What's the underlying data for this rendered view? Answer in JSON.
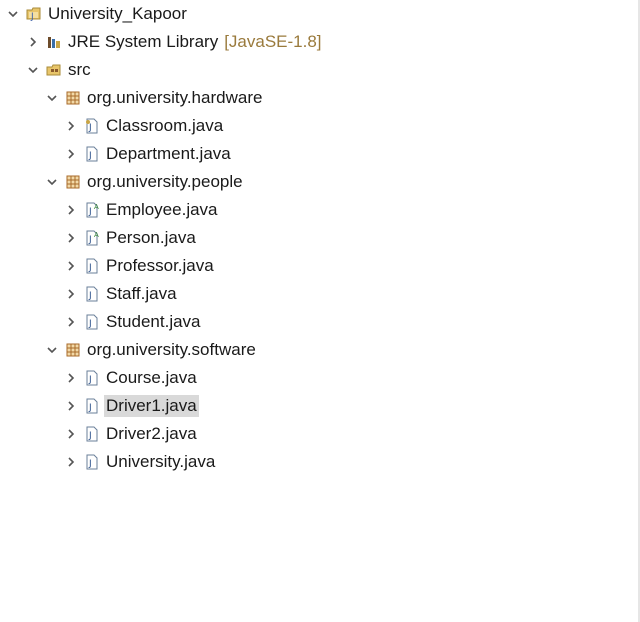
{
  "tree": {
    "project": {
      "label": "University_Kapoor"
    },
    "jre": {
      "label": "JRE System Library",
      "decoration": "[JavaSE-1.8]"
    },
    "src": {
      "label": "src"
    },
    "packages": [
      {
        "label": "org.university.hardware",
        "files": [
          {
            "label": "Classroom.java"
          },
          {
            "label": "Department.java"
          }
        ]
      },
      {
        "label": "org.university.people",
        "files": [
          {
            "label": "Employee.java"
          },
          {
            "label": "Person.java"
          },
          {
            "label": "Professor.java"
          },
          {
            "label": "Staff.java"
          },
          {
            "label": "Student.java"
          }
        ]
      },
      {
        "label": "org.university.software",
        "files": [
          {
            "label": "Course.java"
          },
          {
            "label": "Driver1.java",
            "selected": true
          },
          {
            "label": "Driver2.java"
          },
          {
            "label": "University.java"
          }
        ]
      }
    ]
  },
  "colors": {
    "selection": "#d9d9d9",
    "decoration": "#9a7a3c",
    "chevron": "#555555"
  },
  "icons": {
    "project": "java-project-icon",
    "library": "library-icon",
    "source-folder": "source-folder-icon",
    "package": "package-icon",
    "java-file": "java-file-icon"
  }
}
